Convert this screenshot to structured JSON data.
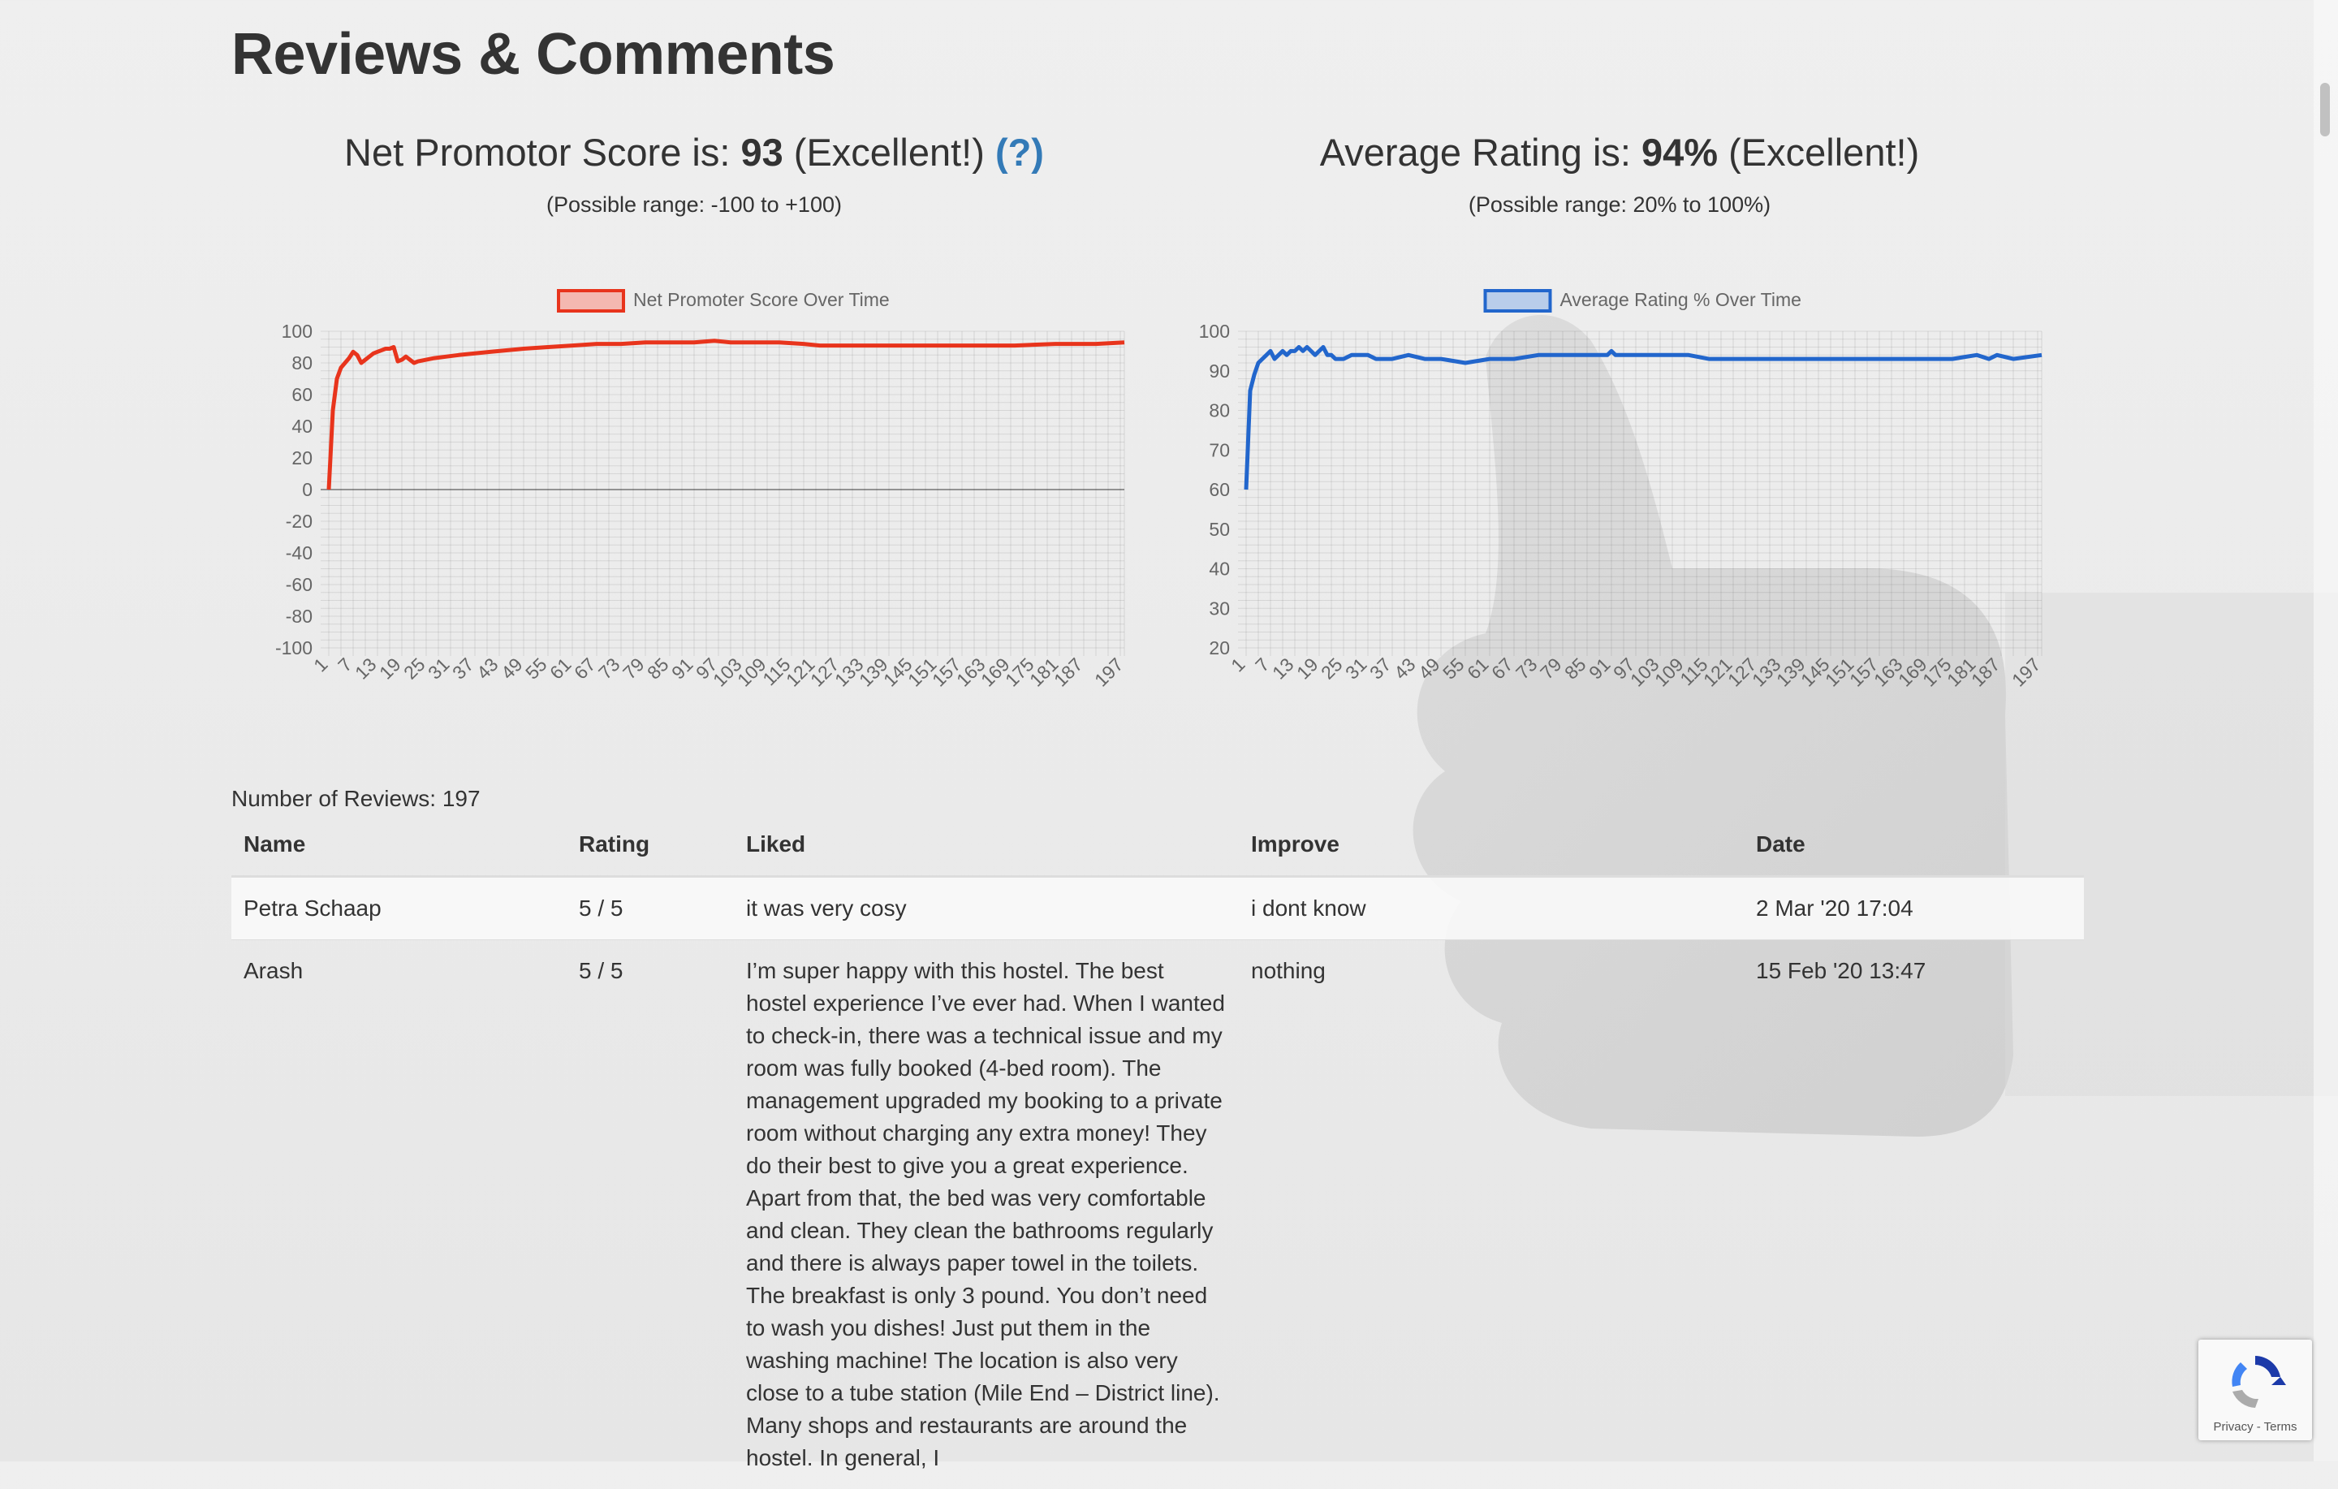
{
  "page": {
    "title": "Reviews & Comments"
  },
  "nps": {
    "heading_prefix": "Net Promotor Score is: ",
    "score": "93",
    "rating_word": " (Excellent!) ",
    "help_link": "(?)",
    "range_note": "(Possible range: -100 to +100)"
  },
  "avg": {
    "heading_prefix": "Average Rating is: ",
    "score": "94%",
    "rating_word": " (Excellent!)",
    "range_note": "(Possible range: 20% to 100%)"
  },
  "chart_data": [
    {
      "type": "line",
      "legend": "Net Promoter Score Over Time",
      "color": "#e8341c",
      "fill": "#f4b8b0",
      "ylim": [
        -100,
        100
      ],
      "yticks": [
        100,
        80,
        60,
        40,
        20,
        0,
        -20,
        -40,
        -60,
        -80,
        -100
      ],
      "x_tick_labels": [
        "1",
        "7",
        "13",
        "19",
        "25",
        "31",
        "37",
        "43",
        "49",
        "55",
        "61",
        "67",
        "73",
        "79",
        "85",
        "91",
        "97",
        "103",
        "109",
        "115",
        "121",
        "127",
        "133",
        "139",
        "145",
        "151",
        "157",
        "163",
        "169",
        "175",
        "181",
        "187",
        "197"
      ],
      "grid": true,
      "legend_position": "top",
      "series": [
        {
          "x": [
            1,
            2,
            3,
            4,
            5,
            6,
            7,
            8,
            9,
            10,
            11,
            12,
            13,
            14,
            15,
            16,
            17,
            18,
            19,
            20,
            21,
            22,
            23,
            25,
            27,
            30,
            33,
            37,
            41,
            45,
            49,
            55,
            61,
            67,
            73,
            79,
            85,
            91,
            96,
            100,
            106,
            112,
            118,
            122,
            128,
            135,
            142,
            150,
            160,
            170,
            180,
            190,
            197
          ],
          "values": [
            0,
            50,
            70,
            77,
            80,
            83,
            87,
            85,
            80,
            82,
            84,
            86,
            87,
            88,
            89,
            89,
            90,
            81,
            82,
            84,
            82,
            80,
            81,
            82,
            83,
            84,
            85,
            86,
            87,
            88,
            89,
            90,
            91,
            92,
            92,
            93,
            93,
            93,
            94,
            93,
            93,
            93,
            92,
            91,
            91,
            91,
            91,
            91,
            91,
            91,
            92,
            92,
            93
          ]
        }
      ]
    },
    {
      "type": "line",
      "legend": "Average Rating % Over Time",
      "color": "#2266cc",
      "fill": "#b9cdea",
      "ylim": [
        20,
        100
      ],
      "yticks": [
        100,
        90,
        80,
        70,
        60,
        50,
        40,
        30,
        20
      ],
      "x_tick_labels": [
        "1",
        "7",
        "13",
        "19",
        "25",
        "31",
        "37",
        "43",
        "49",
        "55",
        "61",
        "67",
        "73",
        "79",
        "85",
        "91",
        "97",
        "103",
        "109",
        "115",
        "121",
        "127",
        "133",
        "139",
        "145",
        "151",
        "157",
        "163",
        "169",
        "175",
        "181",
        "187",
        "197"
      ],
      "grid": true,
      "legend_position": "top",
      "series": [
        {
          "x": [
            1,
            2,
            3,
            4,
            5,
            6,
            7,
            8,
            9,
            10,
            11,
            12,
            13,
            14,
            15,
            16,
            17,
            18,
            19,
            20,
            21,
            22,
            23,
            25,
            27,
            29,
            31,
            33,
            37,
            41,
            45,
            49,
            55,
            61,
            67,
            73,
            79,
            85,
            90,
            91,
            92,
            97,
            103,
            110,
            115,
            121,
            127,
            133,
            145,
            160,
            175,
            181,
            184,
            186,
            190,
            197
          ],
          "values": [
            60,
            85,
            89,
            92,
            93,
            94,
            95,
            93,
            94,
            95,
            94,
            95,
            95,
            96,
            95,
            96,
            95,
            94,
            95,
            96,
            94,
            94,
            93,
            93,
            94,
            94,
            94,
            93,
            93,
            94,
            93,
            93,
            92,
            93,
            93,
            94,
            94,
            94,
            94,
            95,
            94,
            94,
            94,
            94,
            93,
            93,
            93,
            93,
            93,
            93,
            93,
            94,
            93,
            94,
            93,
            94
          ]
        }
      ]
    }
  ],
  "reviews": {
    "count_label": "Number of Reviews: 197",
    "columns": [
      "Name",
      "Rating",
      "Liked",
      "Improve",
      "Date"
    ],
    "rows": [
      {
        "name": "Petra Schaap",
        "rating": "5 / 5",
        "liked": "it was very cosy",
        "improve": "i dont know",
        "date": "2 Mar '20 17:04"
      },
      {
        "name": "Arash",
        "rating": "5 / 5",
        "liked": "I’m super happy with this hostel. The best hostel experience I’ve ever had. When I wanted to check-in, there was a technical issue and my room was fully booked (4-bed room). The management upgraded my booking to a private room without charging any extra money! They do their best to give you a great experience. Apart from that, the bed was very comfortable and clean. They clean the bathrooms regularly and there is always paper towel in the toilets. The breakfast is only 3 pound. You don’t need to wash you dishes! Just put them in the washing machine! The location is also very close to a tube station (Mile End – District line). Many shops and restaurants are around the hostel. In general, I",
        "improve": "nothing",
        "date": "15 Feb '20 13:47"
      }
    ]
  },
  "recaptcha": {
    "links": "Privacy - Terms"
  }
}
